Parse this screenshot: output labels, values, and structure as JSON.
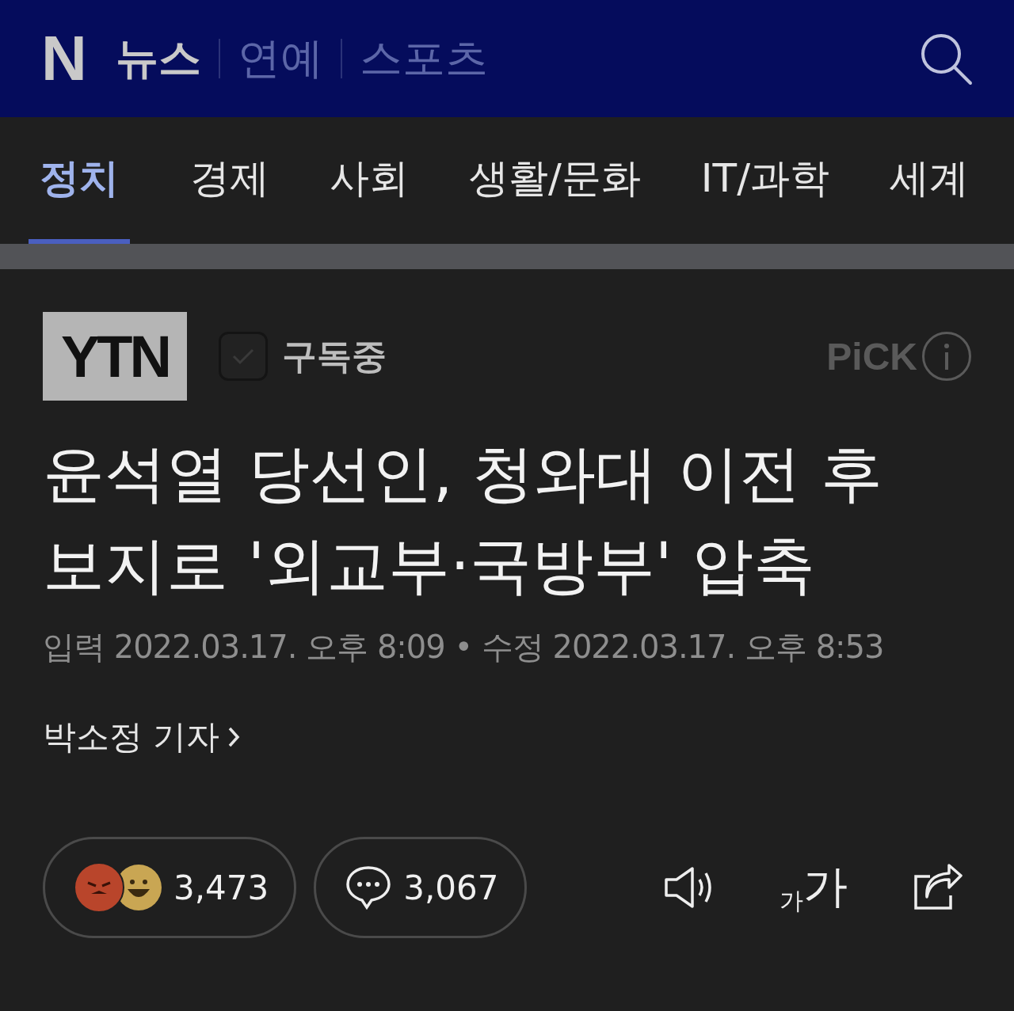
{
  "header": {
    "logo": "N",
    "sections": [
      {
        "label": "뉴스",
        "selected": true
      },
      {
        "label": "연예",
        "selected": false
      },
      {
        "label": "스포츠",
        "selected": false
      }
    ]
  },
  "tabs": [
    {
      "label": "정치",
      "selected": true
    },
    {
      "label": "경제",
      "selected": false
    },
    {
      "label": "사회",
      "selected": false
    },
    {
      "label": "생활/문화",
      "selected": false
    },
    {
      "label": "IT/과학",
      "selected": false
    },
    {
      "label": "세계",
      "selected": false
    }
  ],
  "press": {
    "logo": "YTN",
    "subscribed": true,
    "subscribe_label": "구독중",
    "pick": "PiCK"
  },
  "headline": [
    "윤석열 당선인, 청와대 이전 후",
    "보지로 '외교부·국방부' 압축"
  ],
  "dates": [
    {
      "label": "입력",
      "value": "2022.03.17. 오후 8:09"
    },
    {
      "label": "수정",
      "value": "2022.03.17. 오후 8:53"
    }
  ],
  "date_separator": "•",
  "reporter": "박소정 기자",
  "reactions": {
    "count": "3,473"
  },
  "comments": {
    "count": "3,067"
  },
  "font_size": {
    "small": "가",
    "large": "가"
  }
}
